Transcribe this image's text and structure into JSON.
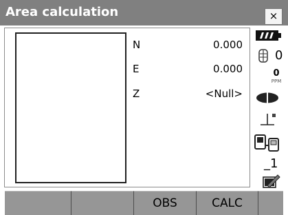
{
  "window": {
    "title": "Area calculation",
    "close_label": "×"
  },
  "coords": {
    "n": {
      "label": "N",
      "value": "0.000"
    },
    "e": {
      "label": "E",
      "value": "0.000"
    },
    "z": {
      "label": "Z",
      "value": "<Null>"
    }
  },
  "status": {
    "battery_icon": "battery-icon",
    "prism_icon": "prism-icon",
    "prism_constant": "0",
    "ppm_value": "0",
    "ppm_label": "PPM",
    "target_icon": "reflectorless-target-icon",
    "tilt_icon": "tilt-compensation-icon",
    "communication_icon": "bluetooth-communication-icon",
    "input_mode": "_1",
    "memory_icon": "memory-card-icon"
  },
  "softkeys": [
    "",
    "",
    "OBS",
    "CALC",
    ""
  ],
  "colors": {
    "title_bar": "#808080",
    "softkey_bg": "#969696",
    "background": "#ffffff"
  }
}
